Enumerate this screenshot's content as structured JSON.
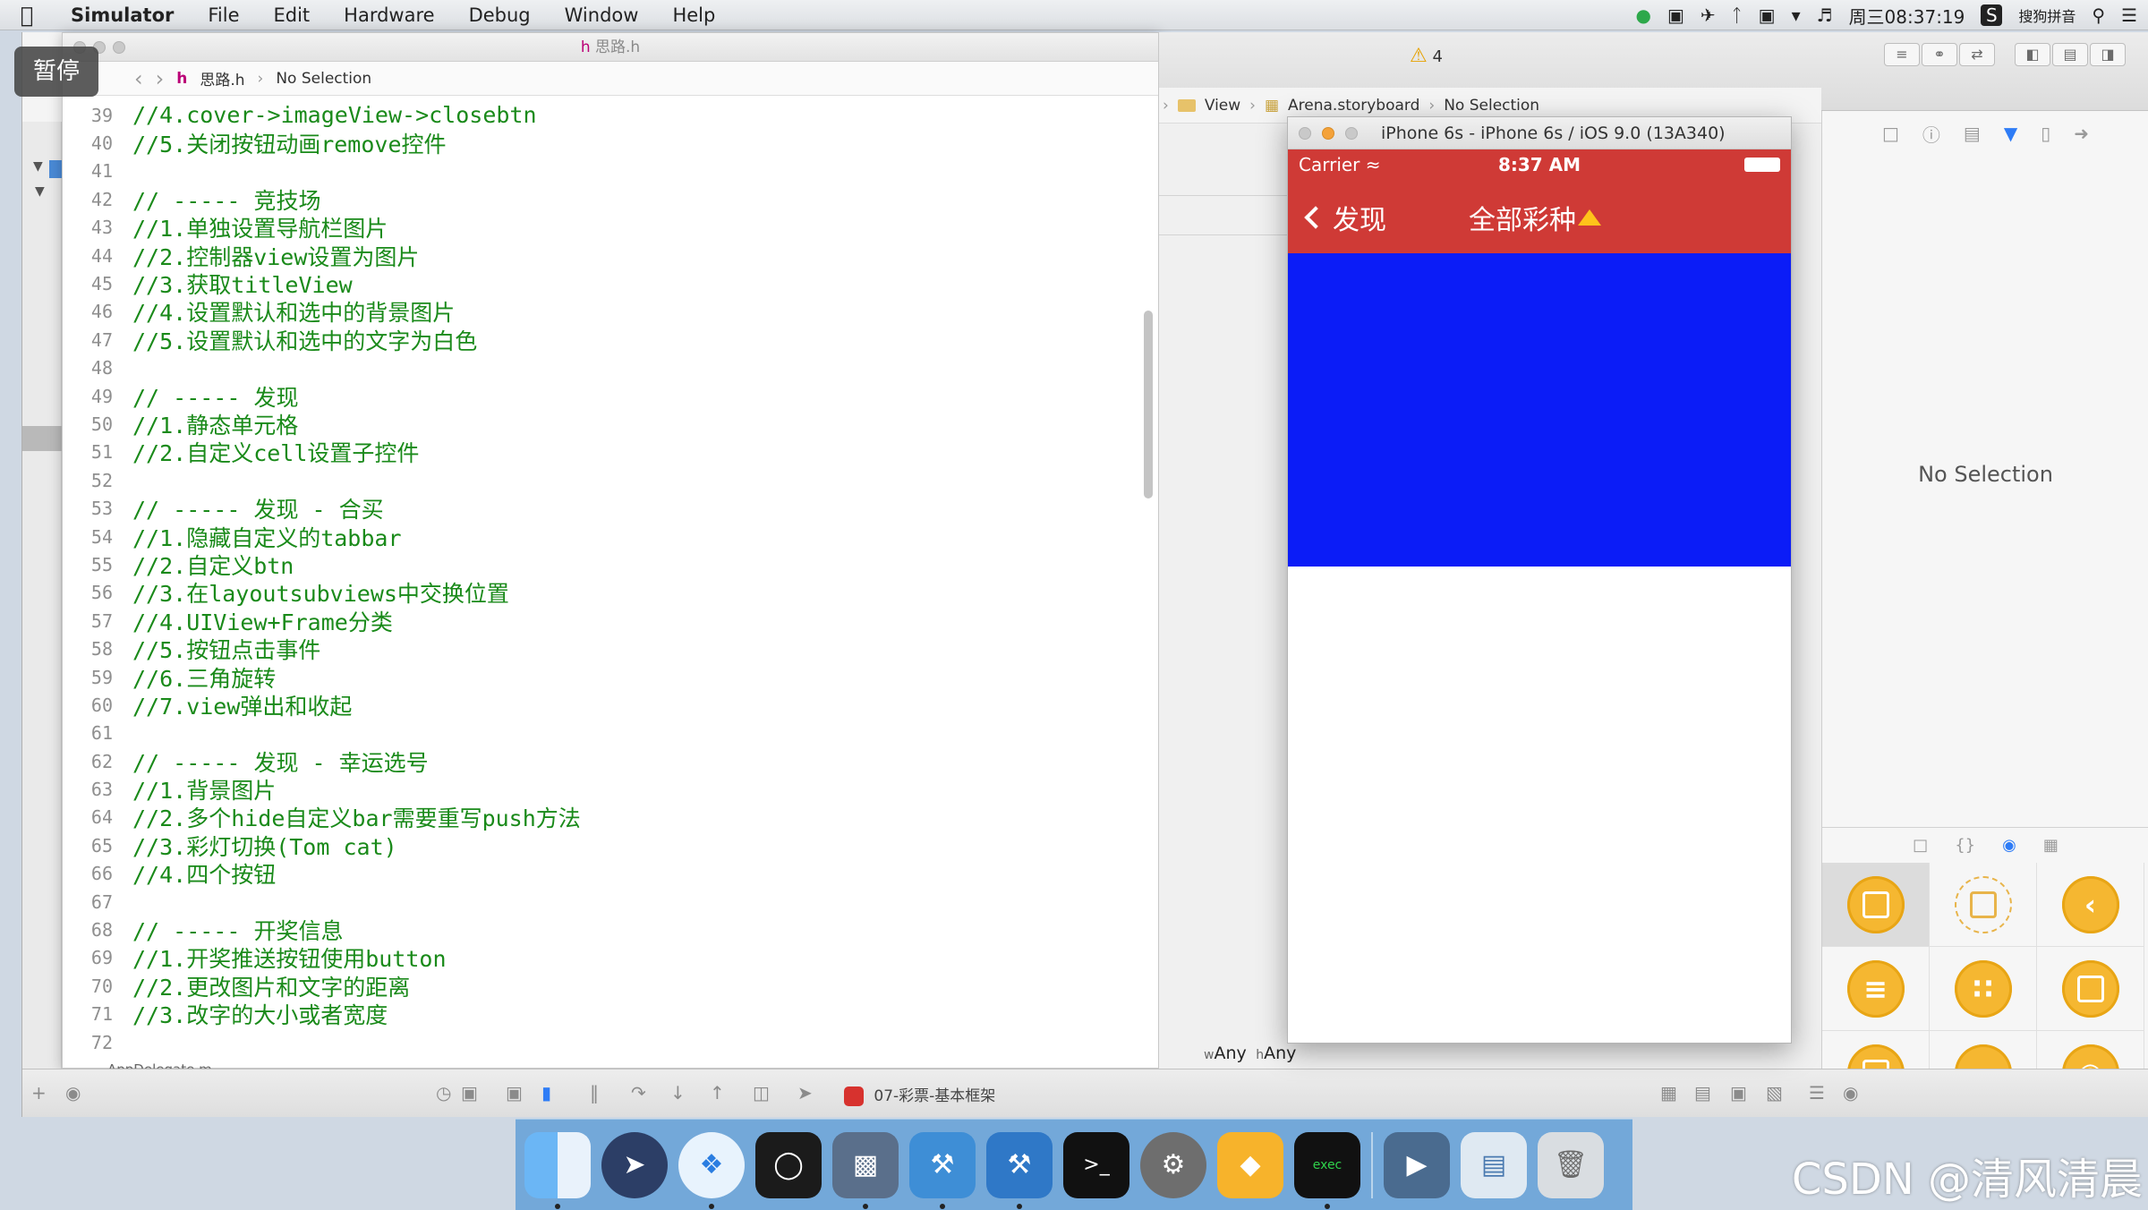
{
  "menubar": {
    "app_name": "Simulator",
    "items": [
      "File",
      "Edit",
      "Hardware",
      "Debug",
      "Window",
      "Help"
    ],
    "clock": "周三08:37:19",
    "input_method": "搜狗拼音"
  },
  "pause_badge": "暂停",
  "editor": {
    "window_title": "思路.h",
    "breadcrumb_file": "思路.h",
    "breadcrumb_selection": "No Selection",
    "footer_file": "AppDelegate.m",
    "lines": [
      {
        "num": "39",
        "code": "//4.cover->imageView->closebtn"
      },
      {
        "num": "40",
        "code": "//5.关闭按钮动画remove控件"
      },
      {
        "num": "41",
        "code": ""
      },
      {
        "num": "42",
        "code": "// ----- 竞技场"
      },
      {
        "num": "43",
        "code": "//1.单独设置导航栏图片"
      },
      {
        "num": "44",
        "code": "//2.控制器view设置为图片"
      },
      {
        "num": "45",
        "code": "//3.获取titleView"
      },
      {
        "num": "46",
        "code": "//4.设置默认和选中的背景图片"
      },
      {
        "num": "47",
        "code": "//5.设置默认和选中的文字为白色"
      },
      {
        "num": "48",
        "code": ""
      },
      {
        "num": "49",
        "code": "// ----- 发现"
      },
      {
        "num": "50",
        "code": "//1.静态单元格"
      },
      {
        "num": "51",
        "code": "//2.自定义cell设置子控件"
      },
      {
        "num": "52",
        "code": ""
      },
      {
        "num": "53",
        "code": "// ----- 发现 - 合买"
      },
      {
        "num": "54",
        "code": "//1.隐藏自定义的tabbar"
      },
      {
        "num": "55",
        "code": "//2.自定义btn"
      },
      {
        "num": "56",
        "code": "//3.在layoutsubviews中交换位置"
      },
      {
        "num": "57",
        "code": "//4.UIView+Frame分类"
      },
      {
        "num": "58",
        "code": "//5.按钮点击事件"
      },
      {
        "num": "59",
        "code": "//6.三角旋转"
      },
      {
        "num": "60",
        "code": "//7.view弹出和收起"
      },
      {
        "num": "61",
        "code": ""
      },
      {
        "num": "62",
        "code": "// ----- 发现 - 幸运选号"
      },
      {
        "num": "63",
        "code": "//1.背景图片"
      },
      {
        "num": "64",
        "code": "//2.多个hide自定义bar需要重写push方法"
      },
      {
        "num": "65",
        "code": "//3.彩灯切换(Tom cat)"
      },
      {
        "num": "66",
        "code": "//4.四个按钮"
      },
      {
        "num": "67",
        "code": ""
      },
      {
        "num": "68",
        "code": "// ----- 开奖信息"
      },
      {
        "num": "69",
        "code": "//1.开奖推送按钮使用button"
      },
      {
        "num": "70",
        "code": "//2.更改图片和文字的距离"
      },
      {
        "num": "71",
        "code": "//3.改字的大小或者宽度"
      },
      {
        "num": "72",
        "code": ""
      }
    ]
  },
  "toolbar": {
    "warning_count": "4"
  },
  "storyboard_jumpbar": {
    "items": [
      "View",
      "Arena.storyboard",
      "No Selection"
    ]
  },
  "size_class": {
    "w": "Any",
    "h": "Any"
  },
  "inspector": {
    "no_selection": "No Selection"
  },
  "debugbar": {
    "scheme": "07-彩票-基本框架"
  },
  "simulator": {
    "title": "iPhone 6s - iPhone 6s / iOS 9.0 (13A340)",
    "carrier": "Carrier",
    "time": "8:37 AM",
    "back_label": "发现",
    "nav_title": "全部彩种",
    "colors": {
      "navbar": "#cf3a36",
      "content": "#0b1cf7",
      "triangle": "#ffc21a"
    }
  },
  "dock": {
    "items": [
      "finder-icon",
      "launchpad-icon",
      "safari-icon",
      "mouse-icon",
      "keynote-icon",
      "xcode-icon",
      "instruments-icon",
      "terminal-icon",
      "system-preferences-icon",
      "sketch-icon",
      "console-icon",
      "quicktime-icon",
      "preview-icon",
      "trash-icon"
    ]
  },
  "watermark": "CSDN @清风清晨"
}
